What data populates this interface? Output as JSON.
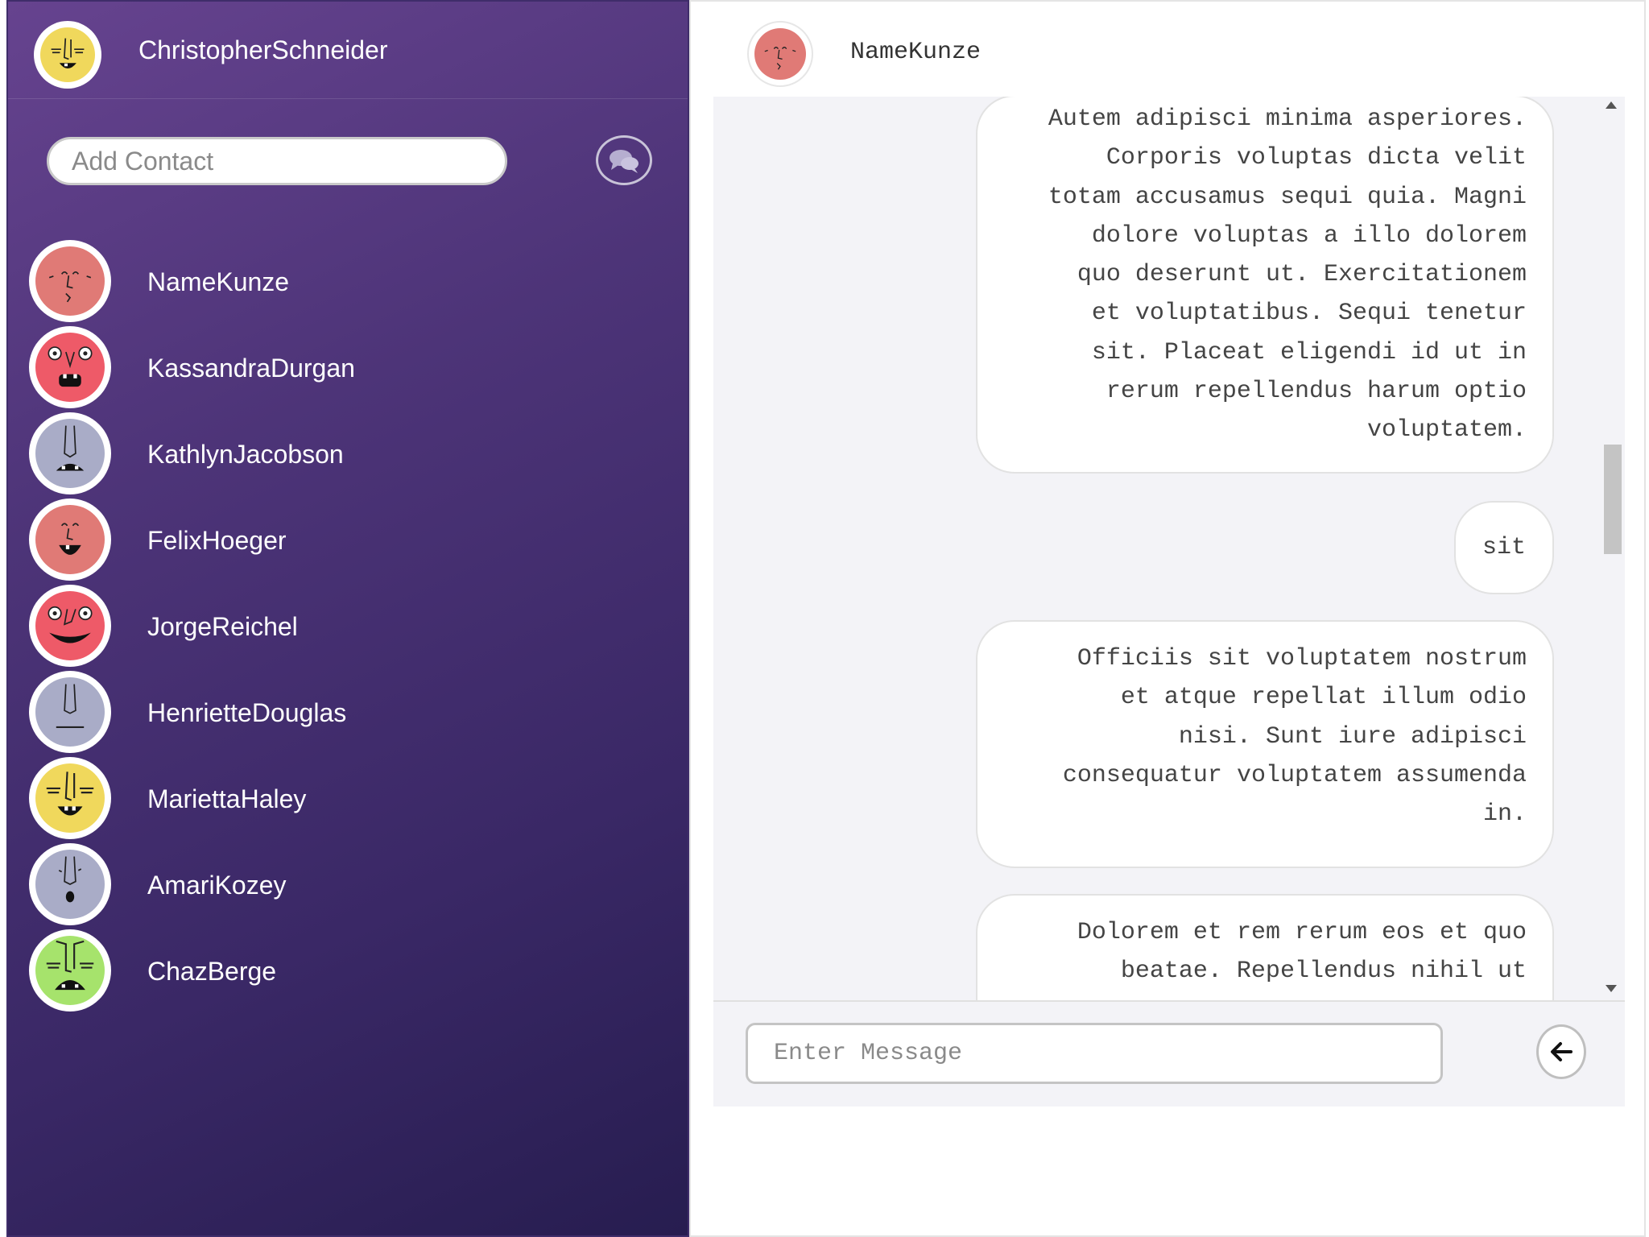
{
  "current_user": {
    "name": "ChristopherSchneider",
    "avatar_icon": "yellow-face-avatar"
  },
  "add_contact": {
    "placeholder": "Add Contact",
    "button_icon": "chat-bubbles-icon"
  },
  "contacts": [
    {
      "name": "NameKunze",
      "avatar_icon": "salmon-face-avatar",
      "color": "#e07a76"
    },
    {
      "name": "KassandraDurgan",
      "avatar_icon": "pink-face-avatar",
      "color": "#ee5a68"
    },
    {
      "name": "KathlynJacobson",
      "avatar_icon": "grey-face-avatar",
      "color": "#a9acc7"
    },
    {
      "name": "FelixHoeger",
      "avatar_icon": "salmon-face-avatar",
      "color": "#e07a76"
    },
    {
      "name": "JorgeReichel",
      "avatar_icon": "pink-face-avatar",
      "color": "#ee5a68"
    },
    {
      "name": "HenrietteDouglas",
      "avatar_icon": "grey-face-avatar",
      "color": "#a9acc7"
    },
    {
      "name": "MariettaHaley",
      "avatar_icon": "yellow-face-avatar",
      "color": "#f0d85c"
    },
    {
      "name": "AmariKozey",
      "avatar_icon": "grey-face-avatar",
      "color": "#a9acc7"
    },
    {
      "name": "ChazBerge",
      "avatar_icon": "green-face-avatar",
      "color": "#a6e36c"
    }
  ],
  "chat": {
    "peer_name": "NameKunze",
    "peer_avatar_icon": "salmon-face-avatar",
    "messages": [
      {
        "lines": [
          "Autem adipisci minima asperiores.",
          "Corporis voluptas dicta velit",
          "totam accusamus sequi quia. Magni",
          "dolore voluptas a illo dolorem",
          "quo deserunt ut. Exercitationem",
          "et voluptatibus. Sequi tenetur",
          "sit. Placeat eligendi id ut in",
          "rerum repellendus harum optio",
          "voluptatem."
        ]
      },
      {
        "lines": [
          "sit"
        ]
      },
      {
        "lines": [
          "Officiis sit voluptatem nostrum",
          "et atque repellat illum odio",
          "nisi. Sunt iure adipisci",
          "consequatur voluptatem assumenda",
          "in."
        ]
      },
      {
        "lines": [
          "Dolorem et rem rerum eos et quo",
          "beatae. Repellendus nihil ut"
        ]
      }
    ],
    "input_placeholder": "Enter Message",
    "send_icon": "arrow-left-icon"
  },
  "colors": {
    "sidebar_top": "#66438f",
    "sidebar_bottom": "#271d50",
    "chat_background": "#f3f3f7"
  }
}
